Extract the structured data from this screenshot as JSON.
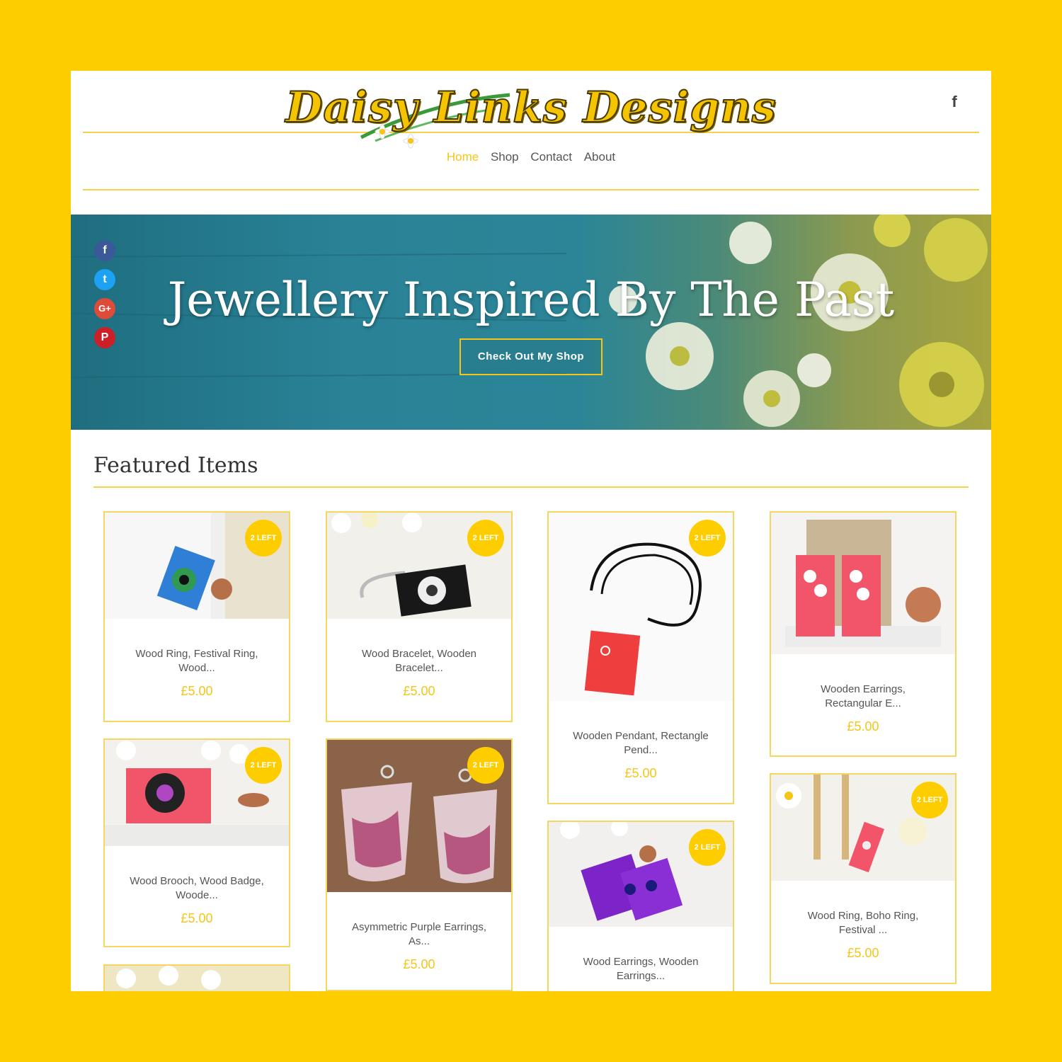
{
  "header": {
    "logo_text": "Daisy Links Designs",
    "facebook_icon": "facebook-icon"
  },
  "nav": {
    "items": [
      {
        "label": "Home",
        "active": true
      },
      {
        "label": "Shop",
        "active": false
      },
      {
        "label": "Contact",
        "active": false
      },
      {
        "label": "About",
        "active": false
      }
    ]
  },
  "hero": {
    "title": "Jewellery Inspired By The Past",
    "button_label": "Check Out My Shop",
    "social_icons": [
      "facebook-icon",
      "twitter-icon",
      "google-plus-icon",
      "pinterest-icon"
    ]
  },
  "featured": {
    "title": "Featured Items",
    "items": [
      {
        "name": "Wood Ring, Festival Ring, Wood...",
        "price": "£5.00",
        "badge": "2 LEFT"
      },
      {
        "name": "Wood Bracelet, Wooden Bracelet...",
        "price": "£5.00",
        "badge": "2 LEFT"
      },
      {
        "name": "Wooden Pendant, Rectangle Pend...",
        "price": "£5.00",
        "badge": "2 LEFT"
      },
      {
        "name": "Wooden Earrings, Rectangular E...",
        "price": "£5.00",
        "badge": ""
      },
      {
        "name": "Wood Brooch, Wood Badge, Woode...",
        "price": "£5.00",
        "badge": "2 LEFT"
      },
      {
        "name": "Asymmetric Purple Earrings, As...",
        "price": "£5.00",
        "badge": "2 LEFT"
      },
      {
        "name": "Wood Earrings, Wooden Earrings...",
        "price": "",
        "badge": "2 LEFT"
      },
      {
        "name": "Wood Ring, Boho Ring, Festival ...",
        "price": "£5.00",
        "badge": "2 LEFT"
      },
      {
        "name": "",
        "price": "",
        "badge": ""
      }
    ]
  },
  "colors": {
    "accent": "#fecd00",
    "price": "#f5c518",
    "hero_teal": "#2a8296"
  }
}
